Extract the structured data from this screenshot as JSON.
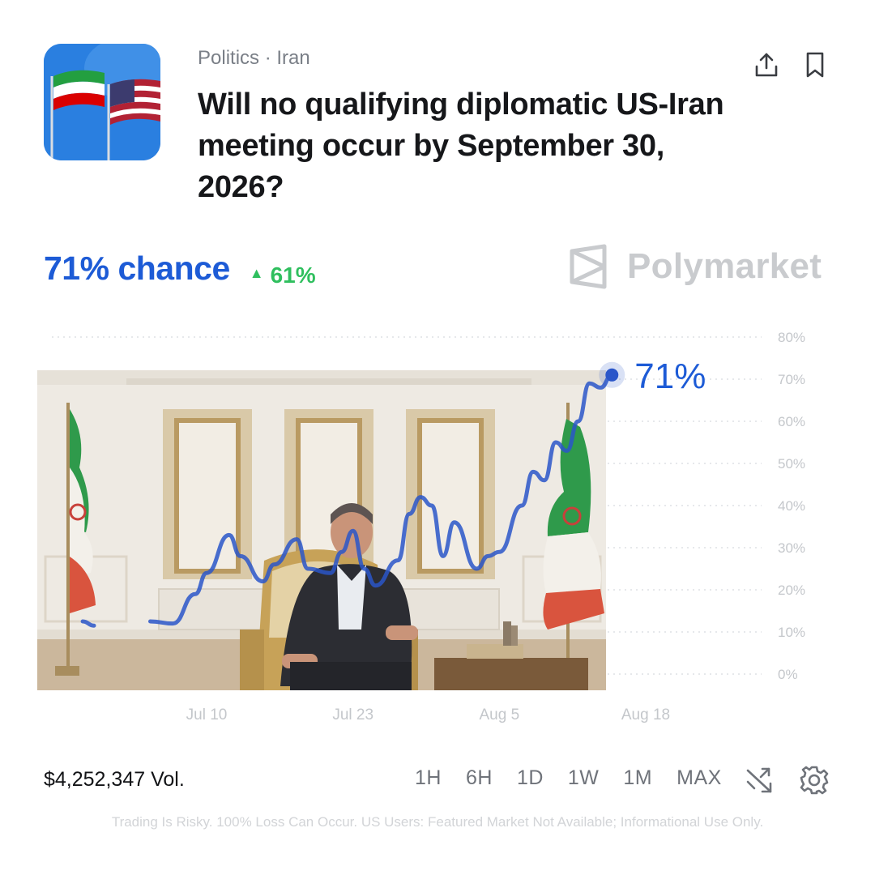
{
  "market": {
    "category": "Politics · Iran",
    "title": "Will no qualifying diplomatic US-Iran meeting occur by September 30, 2026?",
    "chance_text": "71% chance",
    "change_text": "61%",
    "change_direction": "up",
    "brand": "Polymarket",
    "volume": "$4,252,347 Vol.",
    "current_label": "71%",
    "disclaimer": "Trading Is Risky. 100% Loss Can Occur. US Users: Featured Market Not Available; Informational Use Only."
  },
  "time_ranges": [
    "1H",
    "6H",
    "1D",
    "1W",
    "1M",
    "MAX"
  ],
  "icons": {
    "share": "share-icon",
    "bookmark": "bookmark-icon",
    "shuffle": "shuffle-icon",
    "settings": "gear-icon",
    "brand_logo": "polymarket-logo-icon"
  },
  "colors": {
    "accent": "#1d5bd6",
    "up": "#2fbf5e",
    "line": "#2a56c9"
  },
  "chart_data": {
    "type": "line",
    "title": "",
    "xlabel": "",
    "ylabel": "",
    "x_ticks": [
      "Jul 10",
      "Jul 23",
      "Aug 5",
      "Aug 18"
    ],
    "y_ticks": [
      "0%",
      "10%",
      "20%",
      "30%",
      "40%",
      "50%",
      "60%",
      "70%",
      "80%"
    ],
    "ylim": [
      0,
      80
    ],
    "grid": true,
    "series": [
      {
        "values": [
          {
            "x": "Jun 29",
            "y": 12.5
          },
          {
            "x": "Jun 30",
            "y": 11.5
          },
          {
            "x": "Jul 4",
            "y": 11.5
          },
          {
            "x": "Jul 5",
            "y": 12.5
          },
          {
            "x": "Jul 7",
            "y": 12
          },
          {
            "x": "Jul 9",
            "y": 19
          },
          {
            "x": "Jul 10",
            "y": 24
          },
          {
            "x": "Jul 12",
            "y": 33
          },
          {
            "x": "Jul 13",
            "y": 28
          },
          {
            "x": "Jul 15",
            "y": 22
          },
          {
            "x": "Jul 16",
            "y": 26
          },
          {
            "x": "Jul 18",
            "y": 32
          },
          {
            "x": "Jul 19",
            "y": 25
          },
          {
            "x": "Jul 21",
            "y": 24
          },
          {
            "x": "Jul 22",
            "y": 29
          },
          {
            "x": "Jul 23",
            "y": 34
          },
          {
            "x": "Jul 24",
            "y": 25
          },
          {
            "x": "Jul 25",
            "y": 21
          },
          {
            "x": "Jul 27",
            "y": 27
          },
          {
            "x": "Jul 28",
            "y": 38
          },
          {
            "x": "Jul 29",
            "y": 42
          },
          {
            "x": "Jul 30",
            "y": 40
          },
          {
            "x": "Jul 31",
            "y": 28
          },
          {
            "x": "Aug 1",
            "y": 36
          },
          {
            "x": "Aug 3",
            "y": 25
          },
          {
            "x": "Aug 4",
            "y": 28
          },
          {
            "x": "Aug 5",
            "y": 29
          },
          {
            "x": "Aug 7",
            "y": 40
          },
          {
            "x": "Aug 8",
            "y": 48
          },
          {
            "x": "Aug 9",
            "y": 46
          },
          {
            "x": "Aug 10",
            "y": 55
          },
          {
            "x": "Aug 11",
            "y": 53
          },
          {
            "x": "Aug 12",
            "y": 60
          },
          {
            "x": "Aug 13",
            "y": 69
          },
          {
            "x": "Aug 14",
            "y": 68
          },
          {
            "x": "Aug 15",
            "y": 71
          }
        ]
      }
    ]
  }
}
